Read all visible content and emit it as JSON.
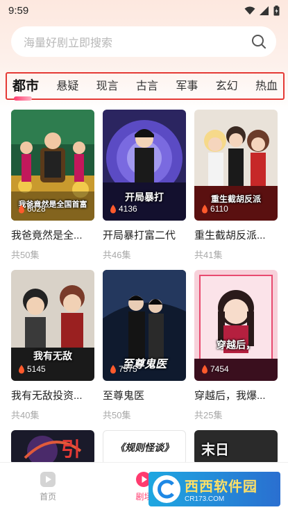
{
  "status": {
    "time": "9:59"
  },
  "search": {
    "placeholder": "海量好剧立即搜索"
  },
  "tabs": [
    {
      "label": "都市",
      "active": true
    },
    {
      "label": "悬疑",
      "active": false
    },
    {
      "label": "现言",
      "active": false
    },
    {
      "label": "古言",
      "active": false
    },
    {
      "label": "军事",
      "active": false
    },
    {
      "label": "玄幻",
      "active": false
    },
    {
      "label": "热血",
      "active": false
    }
  ],
  "cards": [
    {
      "title": "我爸竟然是全...",
      "episodes": "共50集",
      "heat": "6028",
      "caption": "我爸竟然是全国首富"
    },
    {
      "title": "开局暴打富二代",
      "episodes": "共46集",
      "heat": "4136",
      "caption": "开局暴打"
    },
    {
      "title": "重生截胡反派...",
      "episodes": "共41集",
      "heat": "6110",
      "caption": "重生截胡反派"
    },
    {
      "title": "我有无敌投资...",
      "episodes": "共40集",
      "heat": "5145",
      "caption": "我有无敌"
    },
    {
      "title": "至尊鬼医",
      "episodes": "共50集",
      "heat": "7575",
      "caption": "至尊鬼医"
    },
    {
      "title": "穿越后，我爆...",
      "episodes": "共25集",
      "heat": "7454",
      "caption": "穿越后，"
    },
    {
      "caption": "引"
    },
    {
      "caption": "《规则怪谈》"
    },
    {
      "caption": "末日"
    }
  ],
  "nav": [
    {
      "label": "首页",
      "active": false
    },
    {
      "label": "剧场",
      "active": true
    },
    {
      "label": "",
      "active": false
    }
  ],
  "watermark": {
    "main": "西西软件园",
    "sub": "CR173.COM"
  },
  "colors": {
    "accent": "#ff3b6f",
    "highlight_box": "#e53935"
  }
}
